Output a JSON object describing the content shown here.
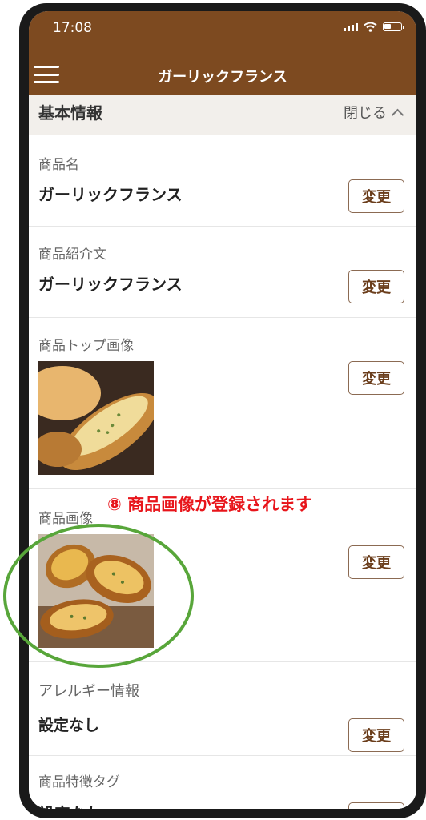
{
  "status_bar": {
    "time": "17:08",
    "battery_level_percent": 40
  },
  "header": {
    "menu_icon": "hamburger-menu-icon",
    "title": "ガーリックフランス"
  },
  "section": {
    "title": "基本情報",
    "toggle_label": "閉じる"
  },
  "fields": [
    {
      "label": "商品名",
      "value": "ガーリックフランス",
      "button": "変更"
    },
    {
      "label": "商品紹介文",
      "value": "ガーリックフランス",
      "button": "変更"
    },
    {
      "label": "商品トップ画像",
      "button": "変更"
    },
    {
      "label": "商品画像",
      "button": "変更"
    },
    {
      "label": "アレルギー情報",
      "value": "設定なし",
      "button": "変更"
    },
    {
      "label": "商品特徴タグ",
      "value": "設定なし",
      "button": "変更"
    }
  ],
  "annotation": {
    "text": "⑧ 商品画像が登録されます"
  },
  "colors": {
    "header_bg": "#7d4a20",
    "accent_text": "#6b3e1c",
    "annotation": "#e8151b",
    "circle": "#58a63a"
  }
}
